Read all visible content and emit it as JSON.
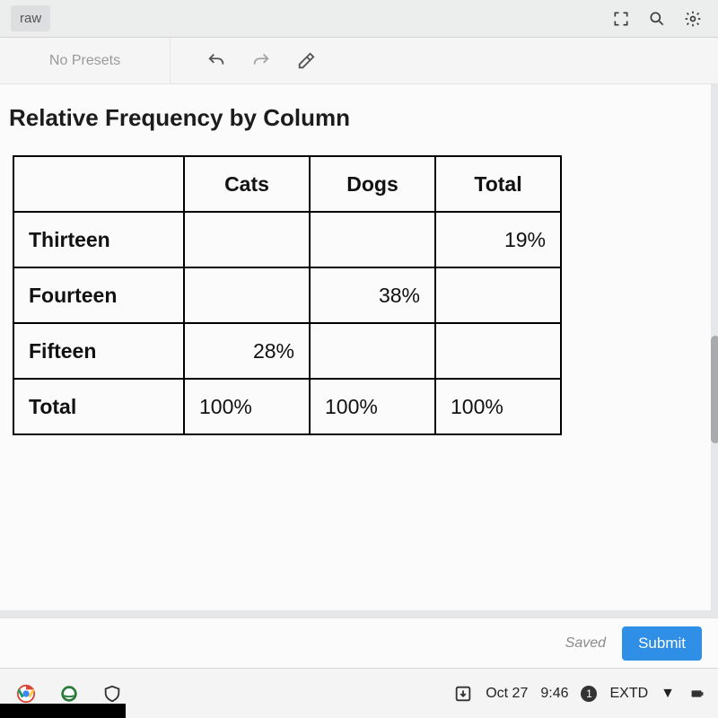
{
  "topbar": {
    "draw_label": "raw"
  },
  "toolbar": {
    "presets_label": "No Presets"
  },
  "content": {
    "title": "Relative Frequency by Column",
    "columns": [
      "",
      "Cats",
      "Dogs",
      "Total"
    ],
    "rows": [
      {
        "label": "Thirteen",
        "cats": "",
        "dogs": "",
        "total": "19%"
      },
      {
        "label": "Fourteen",
        "cats": "",
        "dogs": "38%",
        "total": ""
      },
      {
        "label": "Fifteen",
        "cats": "28%",
        "dogs": "",
        "total": ""
      },
      {
        "label": "Total",
        "cats": "100%",
        "dogs": "100%",
        "total": "100%"
      }
    ]
  },
  "footer": {
    "saved_label": "Saved",
    "submit_label": "Submit"
  },
  "shelf": {
    "date": "Oct 27",
    "time": "9:46",
    "badge": "1",
    "ext": "EXTD"
  }
}
